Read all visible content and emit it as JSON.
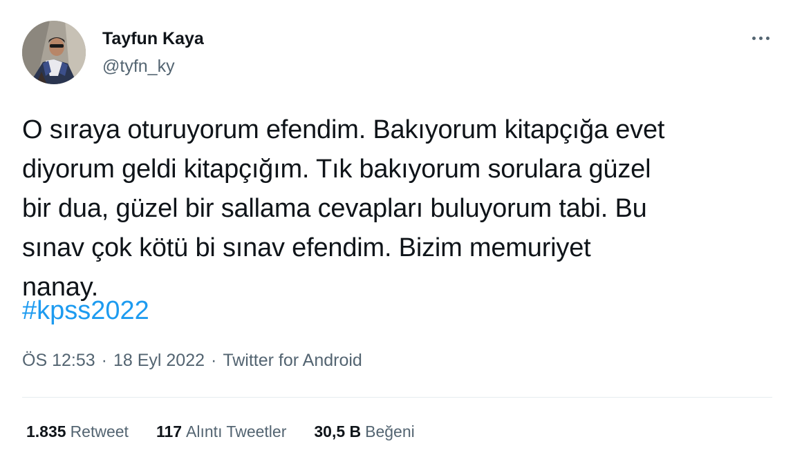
{
  "author": {
    "display_name": "Tayfun Kaya",
    "handle": "@tyfn_ky"
  },
  "tweet": {
    "text": "O sıraya oturuyorum efendim. Bakıyorum kitapçığa evet\ndiyorum geldi kitapçığım. Tık bakıyorum sorulara güzel\nbir dua, güzel bir sallama cevapları buluyorum tabi. Bu\nsınav çok kötü bi sınav efendim. Bizim memuriyet\nnanay.",
    "hashtag": "#kpss2022"
  },
  "meta": {
    "time": "ÖS 12:53",
    "separator": "·",
    "date": "18 Eyl 2022",
    "source": "Twitter for Android"
  },
  "stats": {
    "retweets_count": "1.835",
    "retweets_label": "Retweet",
    "quotes_count": "117",
    "quotes_label": "Alıntı Tweetler",
    "likes_count": "30,5 B",
    "likes_label": "Beğeni"
  },
  "icons": {
    "more": "more-horizontal-icon"
  },
  "colors": {
    "link": "#1d9bf0",
    "secondary_text": "#536471",
    "primary_text": "#0f1419"
  }
}
